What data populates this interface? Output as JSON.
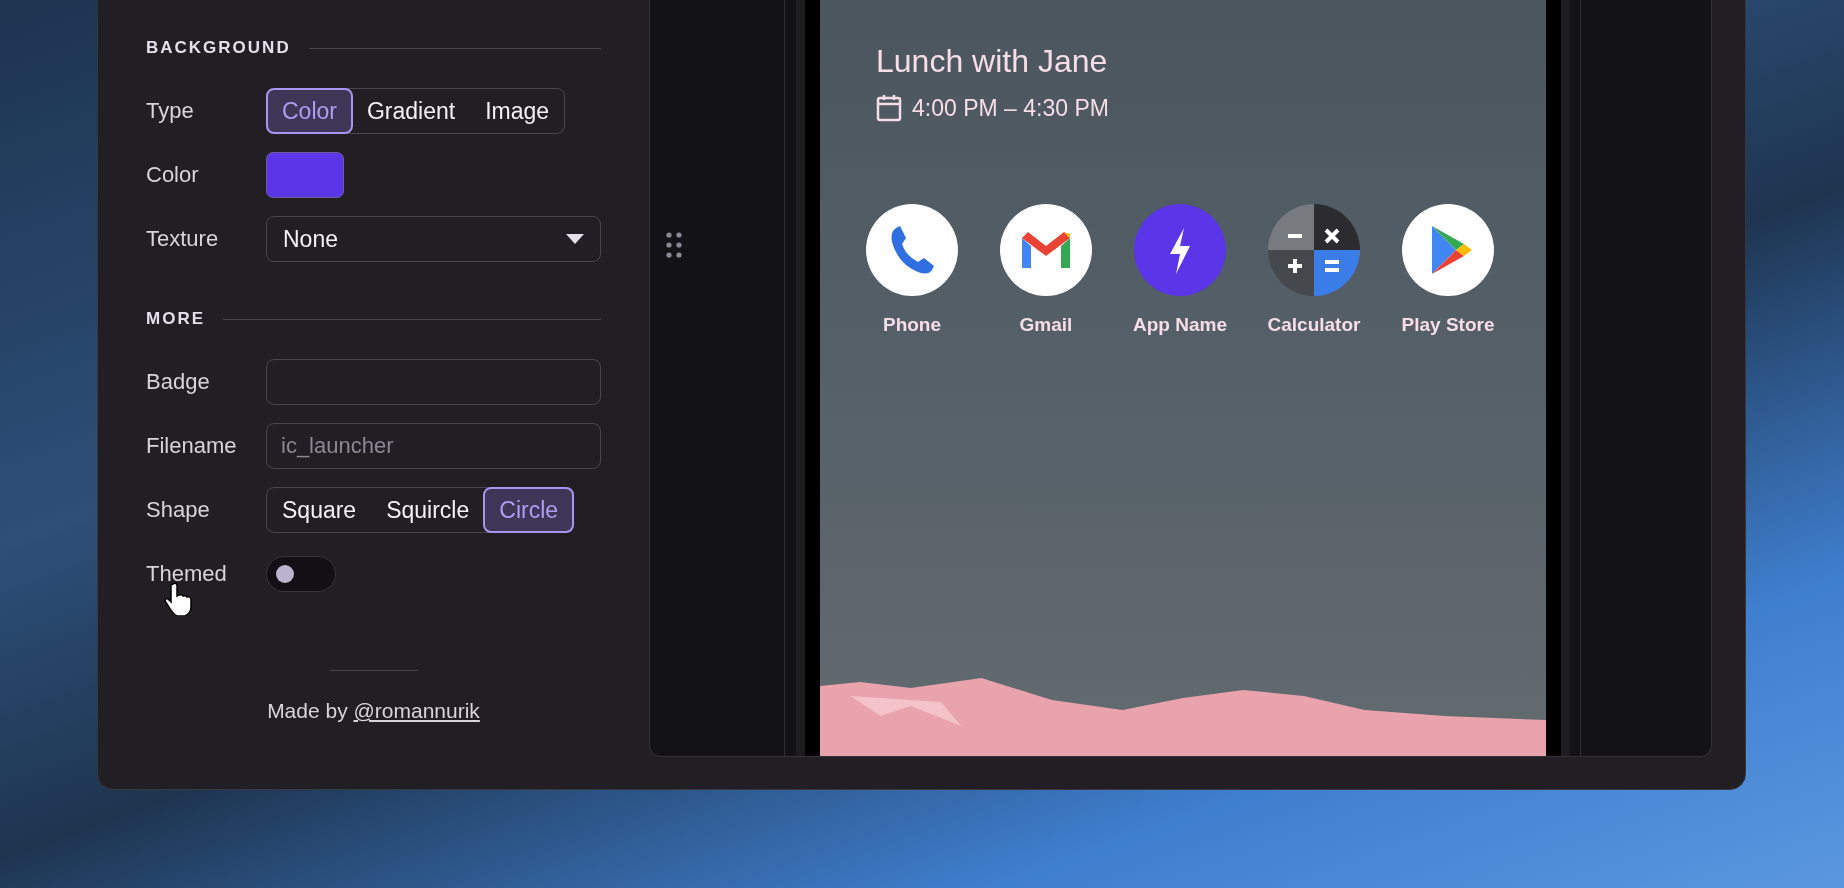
{
  "settings": {
    "sections": [
      {
        "heading": "BACKGROUND",
        "rows": [
          {
            "kind": "segmented",
            "label": "Type",
            "options": [
              {
                "label": "Color",
                "selected": true
              },
              {
                "label": "Gradient",
                "selected": false
              },
              {
                "label": "Image",
                "selected": false
              }
            ]
          },
          {
            "kind": "swatch",
            "label": "Color",
            "color": "#5b35e8"
          },
          {
            "kind": "select",
            "label": "Texture",
            "value": "None"
          }
        ]
      },
      {
        "heading": "MORE",
        "rows": [
          {
            "kind": "text",
            "label": "Badge"
          },
          {
            "kind": "text",
            "label": "Filename",
            "placeholder": "ic_launcher"
          },
          {
            "kind": "segmented",
            "label": "Shape",
            "options": [
              {
                "label": "Square",
                "selected": false
              },
              {
                "label": "Squircle",
                "selected": false
              },
              {
                "label": "Circle",
                "selected": true
              }
            ]
          },
          {
            "kind": "toggle",
            "label": "Themed",
            "on": false
          }
        ]
      }
    ],
    "footer": {
      "text": "Made by",
      "link": "@romannurik"
    }
  },
  "preview": {
    "event": {
      "title": "Lunch with Jane",
      "time": "4:00 PM – 4:30 PM"
    },
    "apps": [
      {
        "kind": "phone",
        "label": "Phone"
      },
      {
        "kind": "gmail",
        "label": "Gmail"
      },
      {
        "kind": "bolt",
        "label": "App Name",
        "color": "#5b35e8"
      },
      {
        "kind": "calculator",
        "label": "Calculator"
      },
      {
        "kind": "play",
        "label": "Play Store"
      }
    ]
  }
}
